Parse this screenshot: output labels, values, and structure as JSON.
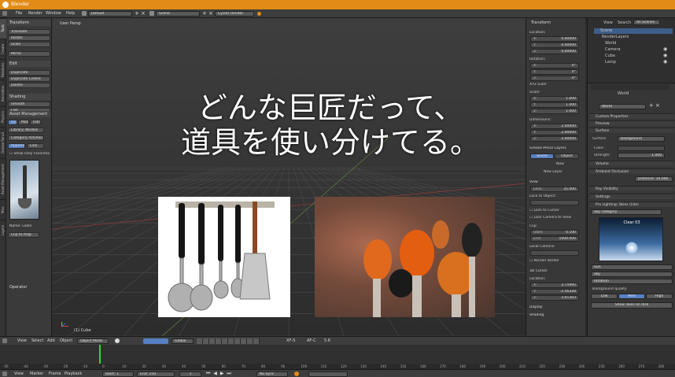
{
  "window": {
    "title": "Blender"
  },
  "topmenu": {
    "items": [
      "File",
      "Render",
      "Window",
      "Help"
    ],
    "screen_layout": "Default",
    "scene": "Scene",
    "render_engine": "Cycles Render"
  },
  "left_tabs": [
    "Tools",
    "Create",
    "Relations",
    "Animation",
    "Physics",
    "Grease Pencil",
    "Asset Management",
    "Misc",
    "Layers"
  ],
  "toolshelf": {
    "transform_header": "Transform",
    "transform_buttons": [
      "Translate",
      "Rotate",
      "Scale",
      "Mirror"
    ],
    "edit_header": "Edit",
    "edit_buttons": [
      "Duplicate",
      "Duplicate Linked",
      "Delete"
    ],
    "history_header": "Shading",
    "history_buttons": [
      "Smooth",
      "Flat"
    ],
    "asset_header": "Asset Management",
    "asset_tabs": [
      "Scene",
      "Mats",
      "Hdri"
    ],
    "asset_rows": [
      "Library: Models",
      "Category: Kitchen",
      "Append",
      "Link"
    ],
    "show_label": "Show Only Favorites",
    "name_label": "Name: Ladle",
    "clip_button": "Clip to map",
    "operator_header": "Operator"
  },
  "viewport": {
    "label": "User Persp",
    "object_label": "(1) Cube"
  },
  "headline": {
    "line1": "どんな巨匠だって、",
    "line2": "道具を使い分けてる。"
  },
  "n_panel": {
    "transform_header": "Transform",
    "location_label": "Location:",
    "location": [
      {
        "axis": "X:",
        "value": "0.00000"
      },
      {
        "axis": "Y:",
        "value": "0.00000"
      },
      {
        "axis": "Z:",
        "value": "0.00000"
      }
    ],
    "rotation_label": "Rotation:",
    "rotation": [
      {
        "axis": "X:",
        "value": "0°"
      },
      {
        "axis": "Y:",
        "value": "0°"
      },
      {
        "axis": "Z:",
        "value": "0°"
      }
    ],
    "rotation_mode": "XYZ Euler",
    "scale_label": "Scale:",
    "scale": [
      {
        "axis": "X:",
        "value": "1.000"
      },
      {
        "axis": "Y:",
        "value": "1.000"
      },
      {
        "axis": "Z:",
        "value": "1.000"
      }
    ],
    "dimensions_label": "Dimensions:",
    "dimensions": [
      {
        "axis": "X:",
        "value": "2.00000"
      },
      {
        "axis": "Y:",
        "value": "2.00000"
      },
      {
        "axis": "Z:",
        "value": "2.00000"
      }
    ],
    "grease_header": "Grease Pencil Layers",
    "grease_tabs": [
      "Scene",
      "Object"
    ],
    "new_label": "New",
    "new_layer": "New Layer",
    "view_header": "View",
    "lens_label": "Lens:",
    "lens_value": "35.000",
    "lock_label": "Lock to Object:",
    "lock_cursor": "Lock to Cursor",
    "lock_camera": "Lock Camera to View",
    "clip_label": "Clip:",
    "clip_start": {
      "axis": "Start:",
      "value": "0.100"
    },
    "clip_end": {
      "axis": "End:",
      "value": "1000.000"
    },
    "local_camera": "Local Camera:",
    "render_border": "Render Border",
    "cursor_header": "3D Cursor",
    "cursor_location": "Location:",
    "cursor": [
      {
        "axis": "X:",
        "value": "3.75995"
      },
      {
        "axis": "Y:",
        "value": "-2.56328"
      },
      {
        "axis": "Z:",
        "value": "3.41303"
      }
    ],
    "display_header": "Display",
    "shading_header": "Shading"
  },
  "outliner": {
    "tabs": [
      "View",
      "Search",
      "All Scenes"
    ],
    "items": [
      "Scene",
      "RenderLayers",
      "World",
      "Camera",
      "Cube",
      "Lamp"
    ]
  },
  "props": {
    "world_label": "World",
    "world_field": "World",
    "panels": [
      "Custom Properties",
      "Preview",
      "Surface"
    ],
    "surface_label": "Surface",
    "surface_value": "Background",
    "color_label": "Color:",
    "strength_label": "Strength:",
    "strength_value": "1.000",
    "panels2": [
      "Volume",
      "Ambient Occlusion"
    ],
    "distance_label": "Distance: 10.000",
    "panels3": [
      "Ray Visibility",
      "Settings",
      "Pro Lighting: Skies (Lite)"
    ],
    "category_label": "Sky category",
    "preview_label": "Clear 03",
    "sliders": [
      "Sun",
      "Sky",
      "Rotation",
      "Background quality"
    ],
    "quality_tabs": [
      "Low",
      "Med",
      "High"
    ],
    "show_button": "Show skies on disk"
  },
  "timeline_header": {
    "items": [
      "View",
      "Select",
      "Add",
      "Object"
    ],
    "mode": "Object Mode",
    "transform": "Global",
    "layer": "XF-S",
    "snap": "AF-C",
    "frame": "5.6"
  },
  "timeline_ruler": [
    "-50",
    "-40",
    "-30",
    "-20",
    "-10",
    "0",
    "10",
    "20",
    "30",
    "40",
    "50",
    "60",
    "70",
    "80",
    "90",
    "100",
    "110",
    "120",
    "130",
    "140",
    "150",
    "160",
    "170",
    "180",
    "190",
    "200",
    "210",
    "220",
    "230",
    "240",
    "250",
    "260",
    "270",
    "280"
  ],
  "bottom_header": {
    "items": [
      "View",
      "Marker",
      "Frame",
      "Playback"
    ],
    "start_label": "Start:",
    "start_value": "1",
    "end_label": "End:",
    "end_value": "250",
    "current_value": "1",
    "sync": "No Sync"
  },
  "colors": {
    "accent": "#e28b16",
    "selection": "#5680c2",
    "playhead": "#3fd13f"
  }
}
